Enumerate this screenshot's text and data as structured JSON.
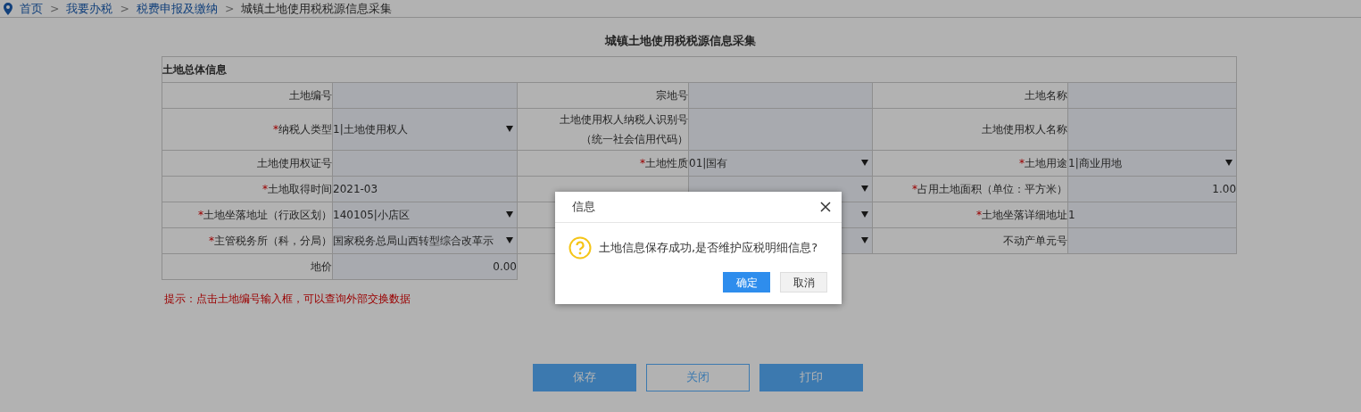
{
  "breadcrumb": [
    {
      "label": "首页",
      "link": true
    },
    {
      "label": "我要办税",
      "link": true
    },
    {
      "label": "税费申报及缴纳",
      "link": true
    },
    {
      "label": "城镇土地使用税税源信息采集",
      "link": false
    }
  ],
  "breadcrumb_separator": ">",
  "required_mark": "*",
  "form": {
    "title": "城镇土地使用税税源信息采集",
    "section": "土地总体信息",
    "rows": [
      [
        {
          "label": "土地编号",
          "required": false,
          "kind": "text"
        },
        {
          "label": "宗地号",
          "required": false,
          "kind": "text"
        },
        {
          "label": "土地名称",
          "required": false,
          "kind": "text"
        }
      ],
      [
        {
          "label": "纳税人类型",
          "required": true,
          "kind": "select",
          "value": "1|土地使用权人"
        },
        {
          "label": "土地使用权人纳税人识别号",
          "label_line_2": "（统一社会信用代码）",
          "required": false,
          "kind": "text"
        },
        {
          "label": "土地使用权人名称",
          "required": false,
          "kind": "text"
        }
      ],
      [
        {
          "label": "土地使用权证号",
          "required": false,
          "kind": "text"
        },
        {
          "label": "土地性质",
          "required": true,
          "kind": "select",
          "value": "01|国有"
        },
        {
          "label": "土地用途",
          "required": true,
          "kind": "select",
          "value": "1|商业用地"
        }
      ],
      [
        {
          "label": "土地取得时间",
          "required": true,
          "kind": "text",
          "value": "2021-03"
        },
        {
          "kind": "select"
        },
        {
          "label": "占用土地面积（单位：平方米）",
          "required": true,
          "kind": "number",
          "value": "1.00"
        }
      ],
      [
        {
          "label": "土地坐落地址（行政区划）",
          "required": true,
          "kind": "select",
          "value": "140105|小店区"
        },
        {
          "kind": "select"
        },
        {
          "label": "土地坐落详细地址",
          "required": true,
          "kind": "text",
          "value": "1"
        }
      ],
      [
        {
          "label": "主管税务所（科，分局）",
          "required": true,
          "kind": "select",
          "value": "国家税务总局山西转型综合改革示"
        },
        {
          "kind": "select"
        },
        {
          "label": "不动产单元号",
          "required": false,
          "kind": "text"
        }
      ],
      [
        {
          "label": "地价",
          "required": false,
          "kind": "number",
          "value": "0.00"
        }
      ]
    ],
    "hint": "提示：点击土地编号输入框，可以查询外部交换数据"
  },
  "buttons": [
    {
      "label": "保存",
      "primary": true
    },
    {
      "label": "关闭",
      "primary": false
    },
    {
      "label": "打印",
      "primary": true
    }
  ],
  "dialog": {
    "title": "信息",
    "message": "土地信息保存成功,是否维护应税明细信息?",
    "buttons": [
      {
        "label": "确定",
        "primary": true
      },
      {
        "label": "取消",
        "primary": false
      }
    ]
  }
}
